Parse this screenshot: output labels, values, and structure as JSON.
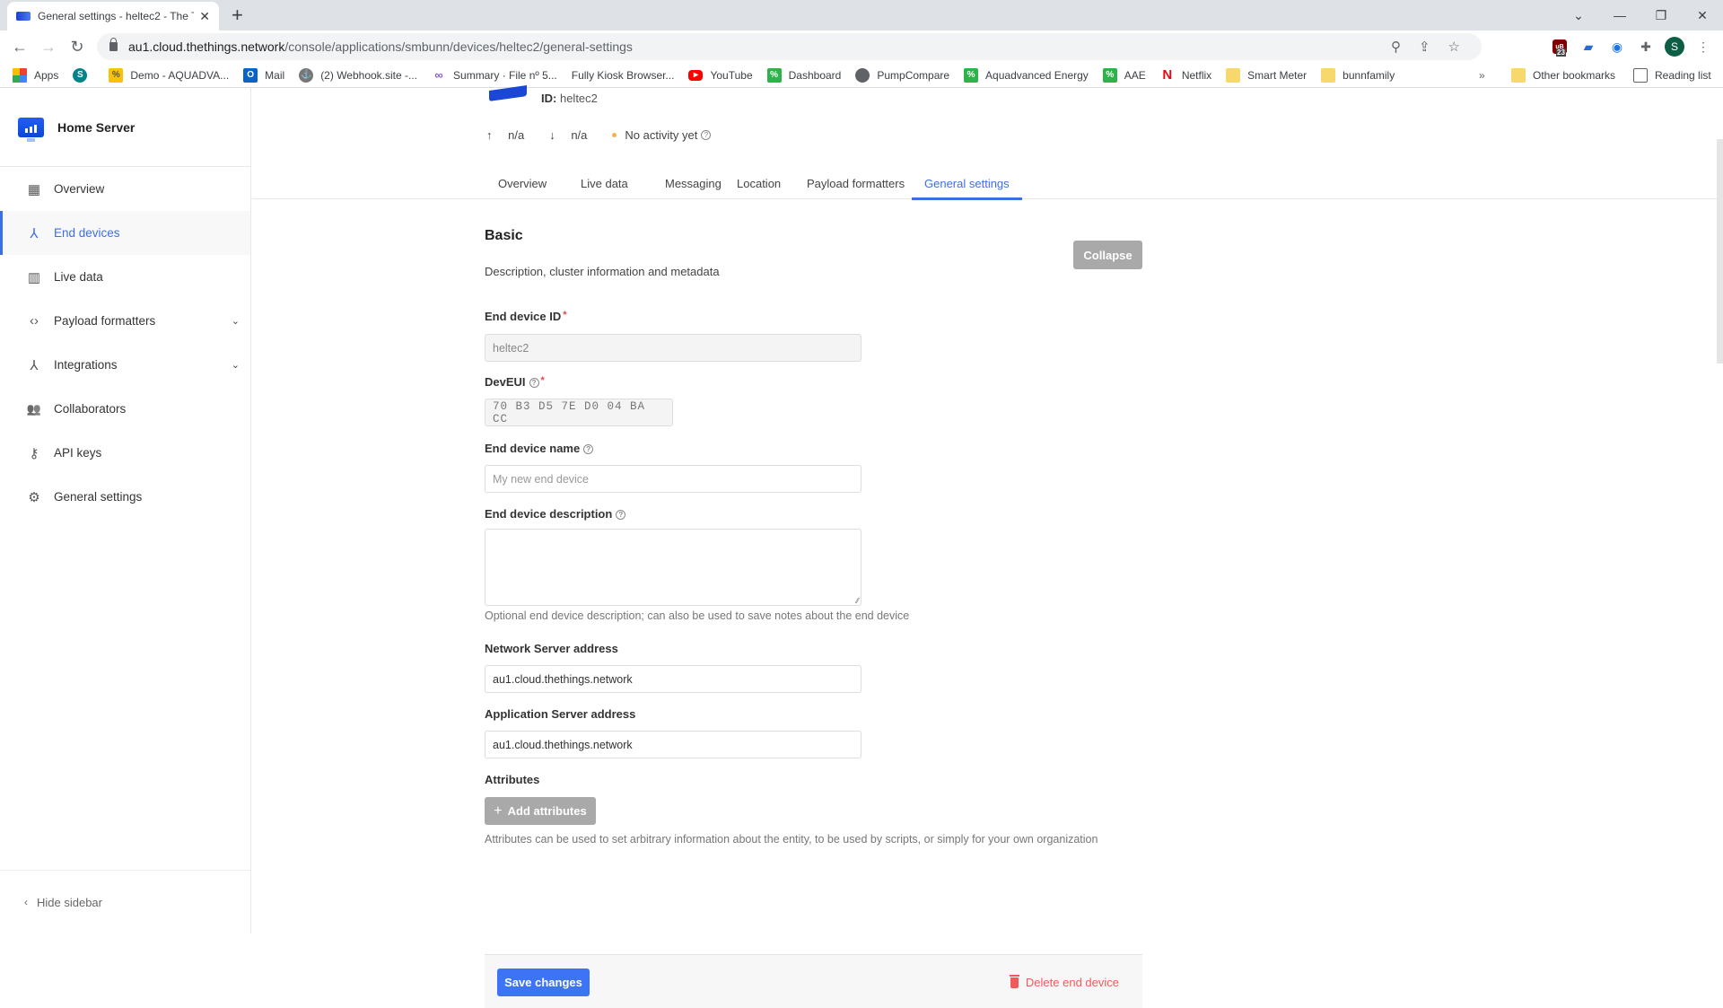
{
  "browser": {
    "tab_title": "General settings - heltec2 - The T",
    "url_host": "au1.cloud.thethings.network",
    "url_path": "/console/applications/smbunn/devices/heltec2/general-settings",
    "extension_badge": "23",
    "profile_initial": "S",
    "bookmarks": [
      {
        "label": "Apps",
        "icon": "apps-grid-icon"
      },
      {
        "label": "",
        "icon": "sharepoint-icon"
      },
      {
        "label": "Demo - AQUADVA...",
        "icon": "yellow-link-icon"
      },
      {
        "label": "Mail",
        "icon": "outlook-icon"
      },
      {
        "label": "(2) Webhook.site -...",
        "icon": "webhook-icon"
      },
      {
        "label": "Summary · File nº 5...",
        "icon": "loop-icon"
      },
      {
        "label": "Fully Kiosk Browser...",
        "icon": "none"
      },
      {
        "label": "YouTube",
        "icon": "youtube-icon"
      },
      {
        "label": "Dashboard",
        "icon": "green-link-icon"
      },
      {
        "label": "PumpCompare",
        "icon": "globe-icon"
      },
      {
        "label": "Aquadvanced Energy",
        "icon": "green-link-icon"
      },
      {
        "label": "AAE",
        "icon": "green-link-icon"
      },
      {
        "label": "Netflix",
        "icon": "netflix-icon"
      },
      {
        "label": "Smart Meter",
        "icon": "folder-icon"
      },
      {
        "label": "bunnfamily",
        "icon": "folder-icon"
      }
    ],
    "overflow": "»",
    "other_bookmarks": "Other bookmarks",
    "reading_list": "Reading list"
  },
  "sidebar": {
    "app_name": "Home Server",
    "items": [
      {
        "label": "Overview",
        "icon": "dashboard-icon",
        "active": false,
        "expandable": false
      },
      {
        "label": "End devices",
        "icon": "devices-icon",
        "active": true,
        "expandable": false
      },
      {
        "label": "Live data",
        "icon": "chart-icon",
        "active": false,
        "expandable": false
      },
      {
        "label": "Payload formatters",
        "icon": "code-icon",
        "active": false,
        "expandable": true
      },
      {
        "label": "Integrations",
        "icon": "merge-icon",
        "active": false,
        "expandable": true
      },
      {
        "label": "Collaborators",
        "icon": "people-icon",
        "active": false,
        "expandable": false
      },
      {
        "label": "API keys",
        "icon": "key-icon",
        "active": false,
        "expandable": false
      },
      {
        "label": "General settings",
        "icon": "gear-icon",
        "active": false,
        "expandable": false
      }
    ],
    "hide_sidebar": "Hide sidebar"
  },
  "device": {
    "id_label": "ID:",
    "id_value": "heltec2",
    "uplink": "n/a",
    "downlink": "n/a",
    "activity": "No activity yet"
  },
  "tabs": [
    {
      "label": "Overview",
      "active": false
    },
    {
      "label": "Live data",
      "active": false
    },
    {
      "label": "Messaging",
      "active": false
    },
    {
      "label": "Location",
      "active": false
    },
    {
      "label": "Payload formatters",
      "active": false
    },
    {
      "label": "General settings",
      "active": true
    }
  ],
  "basic": {
    "title": "Basic",
    "description": "Description, cluster information and metadata",
    "collapse_label": "Collapse",
    "fields": {
      "device_id": {
        "label": "End device ID",
        "value": "heltec2",
        "required": true
      },
      "dev_eui": {
        "label": "DevEUI",
        "value": "70 B3 D5 7E D0 04 BA CC",
        "required": true
      },
      "name": {
        "label": "End device name",
        "placeholder": "My new end device",
        "value": ""
      },
      "description": {
        "label": "End device description",
        "value": "",
        "hint": "Optional end device description; can also be used to save notes about the end device"
      },
      "ns_address": {
        "label": "Network Server address",
        "value": "au1.cloud.thethings.network"
      },
      "as_address": {
        "label": "Application Server address",
        "value": "au1.cloud.thethings.network"
      },
      "attributes": {
        "label": "Attributes",
        "button": "Add attributes",
        "hint": "Attributes can be used to set arbitrary information about the entity, to be used by scripts, or simply for your own organization"
      }
    }
  },
  "footer": {
    "save_label": "Save changes",
    "delete_label": "Delete end device"
  },
  "colors": {
    "accent": "#3c6fe6",
    "danger": "#f05a5a",
    "disabled_button": "#a9a9a9"
  }
}
